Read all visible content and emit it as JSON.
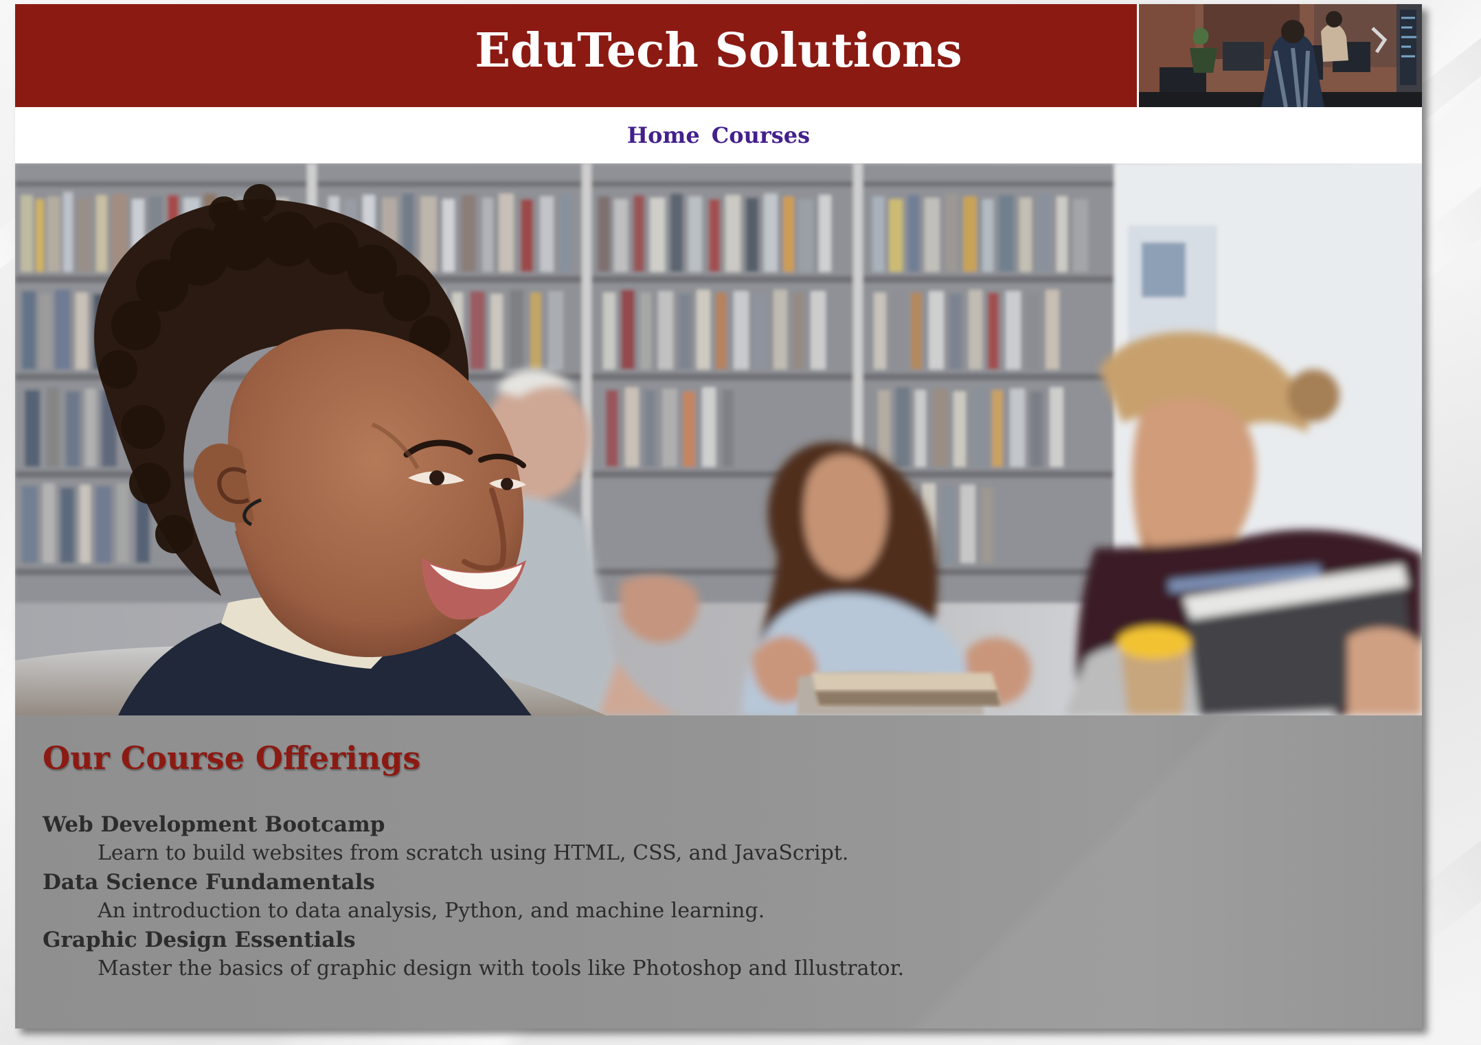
{
  "site": {
    "title": "EduTech Solutions",
    "brand_color": "#8b1a13",
    "nav_color": "#43208c"
  },
  "nav": {
    "items": [
      {
        "label": "Home"
      },
      {
        "label": "Courses"
      }
    ]
  },
  "hero": {
    "image": "students-studying-in-library-photo"
  },
  "courses": {
    "heading": "Our Course Offerings",
    "items": [
      {
        "title": "Web Development Bootcamp",
        "description": "Learn to build websites from scratch using HTML, CSS, and JavaScript."
      },
      {
        "title": "Data Science Fundamentals",
        "description": "An introduction to data analysis, Python, and machine learning."
      },
      {
        "title": "Graphic Design Essentials",
        "description": "Master the basics of graphic design with tools like Photoshop and Illustrator."
      }
    ]
  }
}
